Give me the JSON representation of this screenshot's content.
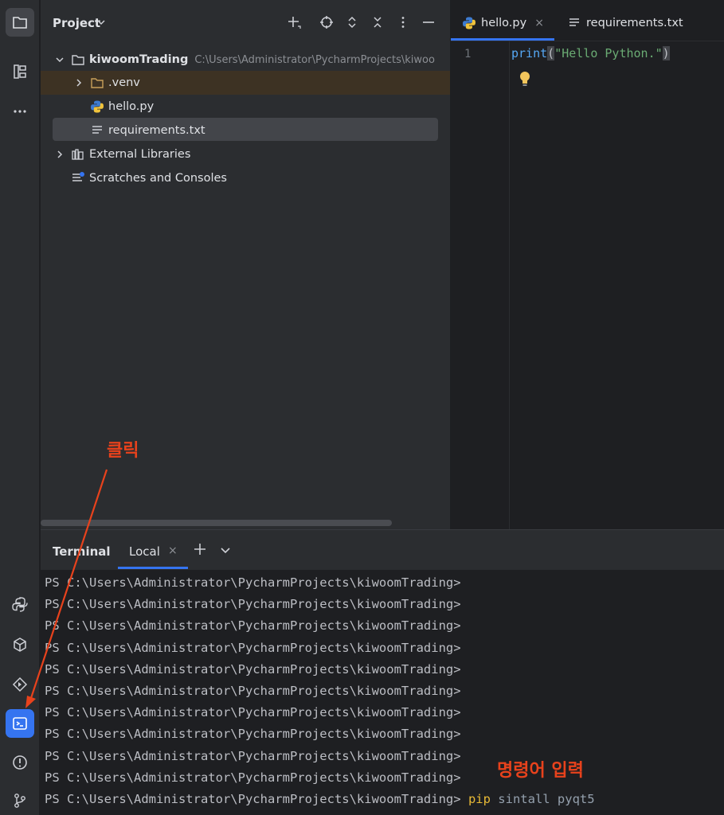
{
  "project_panel": {
    "title": "Project",
    "tree": {
      "root_name": "kiwoomTrading",
      "root_path": "C:\\Users\\Administrator\\PycharmProjects\\kiwoo",
      "venv": ".venv",
      "hello": "hello.py",
      "requirements": "requirements.txt",
      "external": "External Libraries",
      "scratches": "Scratches and Consoles"
    }
  },
  "editor": {
    "tabs": [
      {
        "label": "hello.py",
        "close": "×"
      },
      {
        "label": "requirements.txt"
      }
    ],
    "line_number": "1",
    "code": {
      "fn": "print",
      "open": "(",
      "str": "\"Hello Python.\"",
      "close": ")"
    }
  },
  "terminal": {
    "title": "Terminal",
    "tab_label": "Local",
    "tab_close": "×",
    "prompt": "PS C:\\Users\\Administrator\\PycharmProjects\\kiwoomTrading>",
    "command_pip": "pip",
    "command_args": "sintall pyqt5"
  },
  "annotations": {
    "click": "클릭",
    "enter_command": "명령어 입력",
    "color": "#e8421c"
  },
  "colors": {
    "accent": "#3574f0",
    "background": "#1e1f22",
    "panel": "#2b2d30"
  }
}
